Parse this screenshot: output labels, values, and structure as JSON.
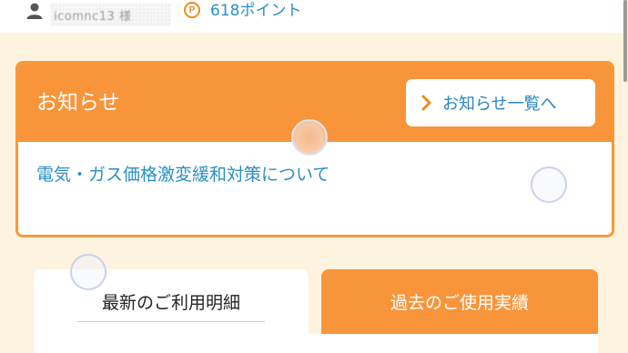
{
  "header": {
    "user_name": "icomnc13 様",
    "points_icon_letter": "P",
    "points_label": "618ポイント",
    "user_icon": "person-icon"
  },
  "news": {
    "title": "お知らせ",
    "list_button_label": "お知らせ一覧へ",
    "list_button_icon": "chevron-right-icon",
    "items": [
      {
        "label": "電気・ガス価格激変緩和対策について"
      }
    ]
  },
  "tabs": [
    {
      "label": "最新のご利用明細",
      "selected": true
    },
    {
      "label": "過去のご使用実績",
      "selected": false
    }
  ],
  "colors": {
    "accent_orange": "#f8953a",
    "link_blue": "#2b8fc4",
    "page_background": "#fdf3df"
  }
}
